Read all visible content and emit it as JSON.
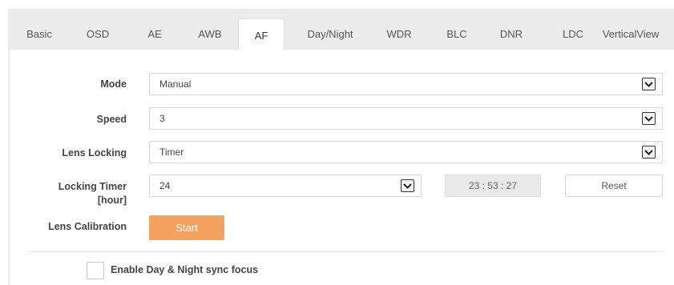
{
  "tabs": [
    {
      "label": "Basic"
    },
    {
      "label": "OSD"
    },
    {
      "label": "AE"
    },
    {
      "label": "AWB"
    },
    {
      "label": "AF"
    },
    {
      "label": "Day/Night"
    },
    {
      "label": "WDR"
    },
    {
      "label": "BLC"
    },
    {
      "label": "DNR"
    },
    {
      "label": "LDC"
    },
    {
      "label": "VerticalView"
    }
  ],
  "active_tab": "AF",
  "form": {
    "mode": {
      "label": "Mode",
      "value": "Manual"
    },
    "speed": {
      "label": "Speed",
      "value": "3"
    },
    "lens_locking": {
      "label": "Lens Locking",
      "value": "Timer"
    },
    "locking_timer": {
      "label_line1": "Locking Timer",
      "label_line2": "[hour]",
      "value": "24",
      "countdown": "23 : 53 : 27",
      "reset_label": "Reset"
    },
    "lens_calibration": {
      "label": "Lens Calibration",
      "start_label": "Start"
    },
    "sync_focus": {
      "label": "Enable Day & Night sync focus",
      "checked": false
    }
  },
  "colors": {
    "accent": "#f5a25f",
    "frame_bg": "#ececec",
    "panel_bg": "#ffffff"
  },
  "icons": {
    "dropdown": "chevron-down-icon"
  }
}
